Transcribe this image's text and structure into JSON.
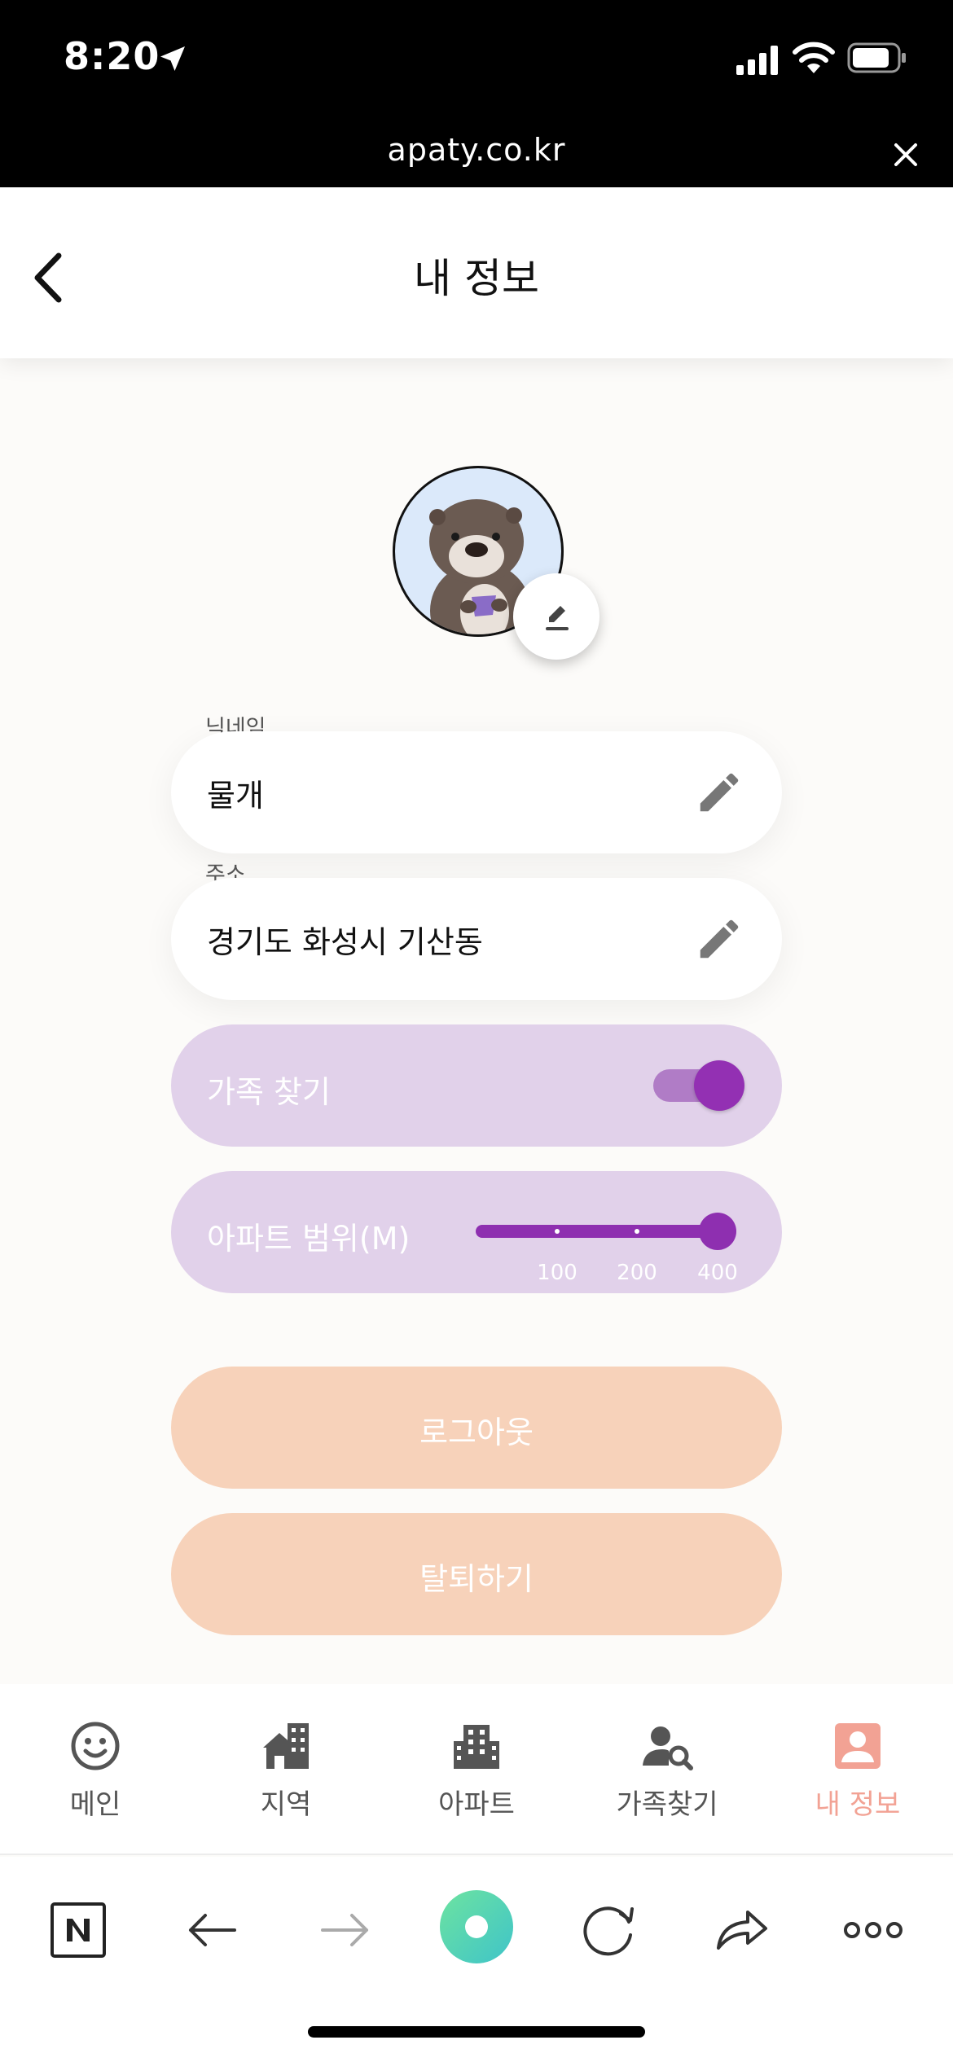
{
  "status_bar": {
    "time": "8:20",
    "url": "apaty.co.kr"
  },
  "header": {
    "title": "내 정보"
  },
  "profile": {
    "nickname_label": "닉네임",
    "nickname_value": "물개",
    "address_label": "주소",
    "address_value": "경기도 화성시 기산동"
  },
  "family_search": {
    "label": "가족 찾기",
    "enabled": true
  },
  "apartment_range": {
    "label": "아파트 범위(M)",
    "ticks": [
      "100",
      "200",
      "400"
    ],
    "value": "400"
  },
  "buttons": {
    "logout": "로그아웃",
    "withdraw": "탈퇴하기"
  },
  "tabs": [
    {
      "label": "메인",
      "icon": "smiley-icon",
      "active": false
    },
    {
      "label": "지역",
      "icon": "region-icon",
      "active": false
    },
    {
      "label": "아파트",
      "icon": "building-icon",
      "active": false
    },
    {
      "label": "가족찾기",
      "icon": "person-search-icon",
      "active": false
    },
    {
      "label": "내 정보",
      "icon": "account-box-icon",
      "active": true
    }
  ],
  "colors": {
    "accent_purple": "#9330b3",
    "pill_purple": "#e1d1ea",
    "peach": "#f7d2ba",
    "active_tab": "#f2a294"
  }
}
